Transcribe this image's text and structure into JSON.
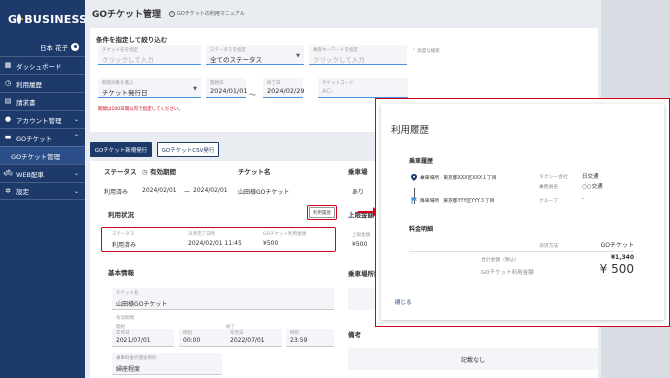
{
  "sidebar": {
    "logo": "G BUSINESS",
    "user_name": "日本 花子",
    "items": [
      {
        "label": "ダッシュボード",
        "icon": "dashboard-icon"
      },
      {
        "label": "利用履歴",
        "icon": "history-icon"
      },
      {
        "label": "請求書",
        "icon": "invoice-icon"
      },
      {
        "label": "アカウント管理",
        "icon": "account-icon"
      },
      {
        "label": "GOチケット",
        "icon": "ticket-icon"
      },
      {
        "label": "GOチケット管理",
        "icon": ""
      },
      {
        "label": "WEB配車",
        "icon": "car-icon"
      },
      {
        "label": "設定",
        "icon": "gear-icon"
      }
    ]
  },
  "header": {
    "title": "GOチケット管理",
    "manual_link": "GOチケットの利用マニュアル"
  },
  "filter": {
    "title": "条件を指定して絞り込む",
    "ticket_name_label": "チケット名を指定",
    "ticket_name_placeholder": "クリックして入力",
    "status_label": "ステータスを指定",
    "status_value": "全てのステータス",
    "keyword_label": "乗客キーワードを指定",
    "keyword_placeholder": "クリックして入力",
    "advanced": "高度な検索",
    "date_type_label": "期間対象を選ぶ",
    "date_type_value": "チケット発行日",
    "start_label": "開始日",
    "start_value": "2024/01/01",
    "tilde": "〜",
    "end_label": "終了日",
    "end_value": "2024/02/29",
    "code_label": "チケットコード",
    "code_placeholder": "AC-",
    "note": "期間は100日間以内で指定してください。"
  },
  "actions": {
    "new_ticket": "GOチケット新規発行",
    "csv": "GOチケットCSV発行"
  },
  "table": {
    "headers": {
      "status": "ステータス",
      "period": "有効期間",
      "ticket_name": "チケット名",
      "fare_limit": "乗車場"
    },
    "row": {
      "status": "利用済み",
      "period_start": "2024/02/01",
      "period_sep": "ー",
      "period_end": "2024/02/01",
      "ticket_name": "山田様GOチケット",
      "fare_limit": "あり"
    }
  },
  "usage": {
    "heading": "利用状況",
    "history_button": "利用履歴",
    "status_key": "ステータス",
    "status_val": "利用済み",
    "datetime_key": "決済完了日時",
    "datetime_val": "2024/02/01 11:45",
    "amount_key": "GOチケット利用金額",
    "amount_val": "¥500",
    "limit_heading": "上限金額",
    "limit_key": "上限金額",
    "limit_val": "¥500",
    "area_heading": "乗車場所制限"
  },
  "basic": {
    "heading": "基本情報",
    "ticket_name_key": "チケット名",
    "ticket_name_val": "山田様GOチケット",
    "period_key": "有効期間",
    "start_key": "開始",
    "start_date_key": "年月日",
    "start_date_val": "2021/07/01",
    "start_time_key": "時刻",
    "start_time_val": "00:00",
    "end_key": "終了",
    "end_date_key": "年月日",
    "end_date_val": "2022/07/01",
    "end_time_key": "時刻",
    "end_time_val": "23:59",
    "usage_key": "乗車料金の使途目的",
    "usage_val": "婦座程度"
  },
  "remarks": {
    "heading": "備考",
    "empty": "記載なし"
  },
  "modal": {
    "title": "利用履歴",
    "ride_heading": "乗車履歴",
    "pickup_label": "乗車場所",
    "pickup_value": "東京都XXX区XXX１丁目",
    "dropoff_label": "降車場所",
    "dropoff_value": "東京都YYY区YYY３丁目",
    "taxi_company_key": "タクシー会社",
    "taxi_company_val": "日交通",
    "driver_key": "乗務員名",
    "driver_val": "○○交通",
    "group_key": "グループ",
    "group_val": "-",
    "fare_heading": "料金明細",
    "payment_key": "決済方法",
    "payment_val": "GOチケット",
    "total_key": "合計金額（税込）",
    "total_val": "¥1,340",
    "ticket_amount_key": "GOチケット利用金額",
    "ticket_amount_val": "¥ 500",
    "close": "閉じる"
  },
  "colors": {
    "sidebar": "#1e3a6b",
    "accent": "#4a90e2",
    "highlight": "#d0021b"
  }
}
